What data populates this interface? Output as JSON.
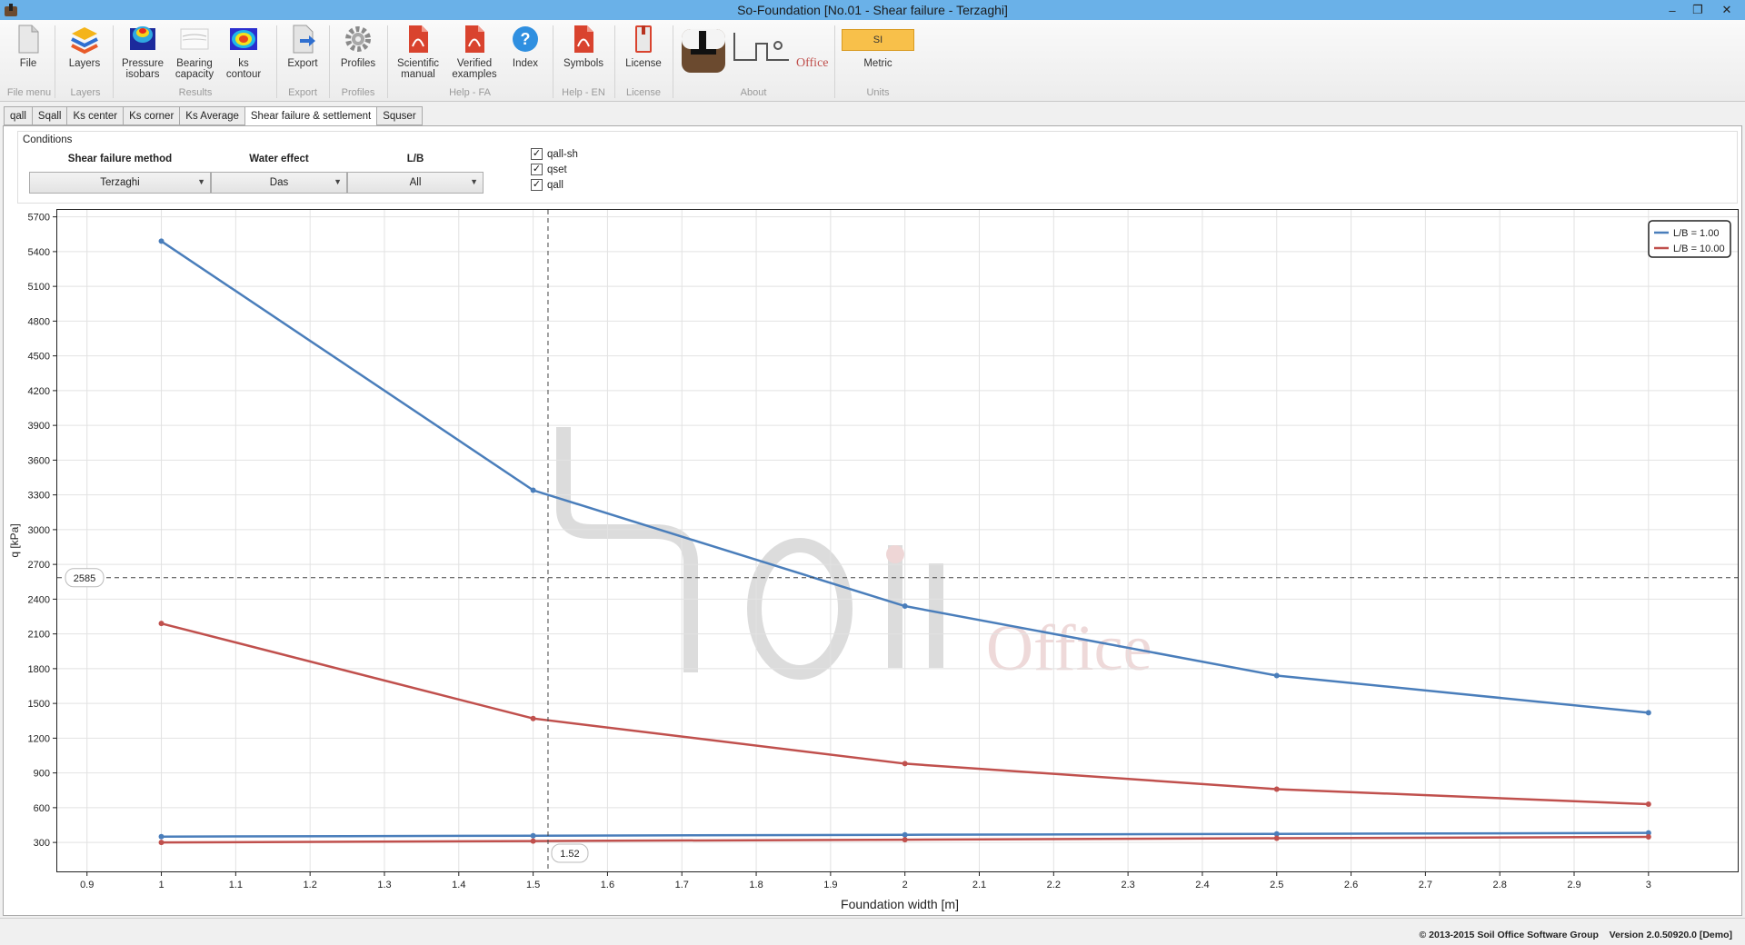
{
  "window": {
    "title": "So-Foundation [No.01 - Shear failure - Terzaghi]",
    "minimize": "–",
    "restore": "❐",
    "close": "✕"
  },
  "ribbon": {
    "buttons": [
      {
        "label": "File",
        "icon": "file-icon"
      },
      {
        "label": "Layers",
        "icon": "layers-icon"
      },
      {
        "label": "Pressure isobars",
        "icon": "pressure-isobars-icon"
      },
      {
        "label": "Bearing capacity",
        "icon": "bearing-capacity-icon"
      },
      {
        "label": "ks contour",
        "icon": "ks-contour-icon"
      },
      {
        "label": "Export",
        "icon": "export-icon"
      },
      {
        "label": "Profiles",
        "icon": "gear-icon"
      },
      {
        "label": "Scientific manual",
        "icon": "pdf-icon"
      },
      {
        "label": "Verified examples",
        "icon": "pdf-icon"
      },
      {
        "label": "Index",
        "icon": "help-icon"
      },
      {
        "label": "Symbols",
        "icon": "pdf-icon"
      },
      {
        "label": "License",
        "icon": "license-icon"
      },
      {
        "label": "Metric",
        "icon": "units-icon"
      }
    ],
    "units_badge": "SI",
    "groups": [
      "File menu",
      "Layers",
      "Results",
      "Export",
      "Profiles",
      "Help - FA",
      "Help - EN",
      "License",
      "About",
      "Units"
    ],
    "logo_text": "Office"
  },
  "tabs": [
    "qall",
    "Sqall",
    "Ks center",
    "Ks corner",
    "Ks Average",
    "Shear failure & settlement",
    "Squser"
  ],
  "active_tab": "Shear failure & settlement",
  "conditions": {
    "title": "Conditions",
    "shear_label": "Shear failure method",
    "shear_value": "Terzaghi",
    "water_label": "Water effect",
    "water_value": "Das",
    "lb_label": "L/B",
    "lb_value": "All",
    "checks": [
      {
        "label": "qall-sh",
        "checked": true
      },
      {
        "label": "qset",
        "checked": true
      },
      {
        "label": "qall",
        "checked": true
      }
    ]
  },
  "chart_data": {
    "type": "line",
    "xlabel": "Foundation width [m]",
    "ylabel": "q [kPa]",
    "xlim": [
      0.86,
      3.12
    ],
    "ylim": [
      50,
      5760
    ],
    "xticks": [
      0.9,
      1,
      1.1,
      1.2,
      1.3,
      1.4,
      1.5,
      1.6,
      1.7,
      1.8,
      1.9,
      2,
      2.1,
      2.2,
      2.3,
      2.4,
      2.5,
      2.6,
      2.7,
      2.8,
      2.9,
      3
    ],
    "yticks": [
      300,
      600,
      900,
      1200,
      1500,
      1800,
      2100,
      2400,
      2700,
      3000,
      3300,
      3600,
      3900,
      4200,
      4500,
      4800,
      5100,
      5400,
      5700
    ],
    "grid": true,
    "legend_position": "top-right",
    "legend": [
      "L/B = 1.00",
      "L/B = 10.00"
    ],
    "series": [
      {
        "name": "L/B = 1.00",
        "color": "#4a7ebb",
        "x": [
          1,
          1.5,
          2,
          2.5,
          3
        ],
        "y": [
          5490,
          3340,
          2340,
          1740,
          1420
        ]
      },
      {
        "name": "L/B = 10.00",
        "color": "#c0504d",
        "x": [
          1,
          1.5,
          2,
          2.5,
          3
        ],
        "y": [
          2190,
          1370,
          980,
          760,
          630
        ]
      },
      {
        "name": "L/B = 1.00",
        "color": "#4a7ebb",
        "x": [
          1,
          1.5,
          2,
          2.5,
          3
        ],
        "y": [
          350,
          358,
          366,
          374,
          382
        ]
      },
      {
        "name": "L/B = 10.00",
        "color": "#c0504d",
        "x": [
          1,
          1.5,
          2,
          2.5,
          3
        ],
        "y": [
          300,
          312,
          324,
          336,
          348
        ]
      }
    ],
    "crosshair": {
      "x": 1.52,
      "y": 2585,
      "x_label": "1.52",
      "y_label": "2585"
    },
    "watermark": "Office"
  },
  "status": {
    "copyright": "© 2013-2015 Soil Office Software Group",
    "version": "Version 2.0.50920.0 [Demo]"
  }
}
